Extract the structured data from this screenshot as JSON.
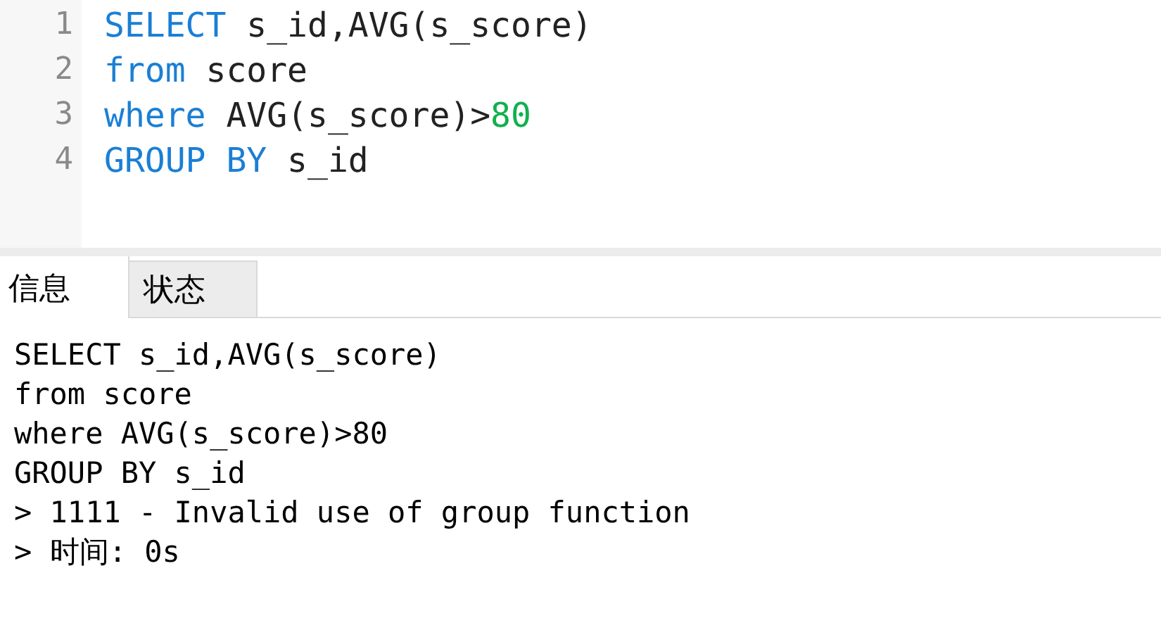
{
  "editor": {
    "lines": [
      {
        "number": "1",
        "tokens": [
          {
            "kind": "keyword",
            "text": "SELECT"
          },
          {
            "kind": "plain",
            "text": " s_id,AVG(s_score)"
          }
        ]
      },
      {
        "number": "2",
        "tokens": [
          {
            "kind": "keyword",
            "text": "from"
          },
          {
            "kind": "plain",
            "text": " score"
          }
        ]
      },
      {
        "number": "3",
        "tokens": [
          {
            "kind": "keyword",
            "text": "where"
          },
          {
            "kind": "plain",
            "text": " AVG(s_score)>"
          },
          {
            "kind": "number",
            "text": "80"
          }
        ]
      },
      {
        "number": "4",
        "tokens": [
          {
            "kind": "keyword",
            "text": "GROUP BY"
          },
          {
            "kind": "plain",
            "text": " s_id"
          }
        ]
      }
    ]
  },
  "tabs": [
    {
      "label": "信息",
      "selected": true
    },
    {
      "label": "状态",
      "selected": false
    }
  ],
  "output": {
    "lines": [
      "SELECT s_id,AVG(s_score)",
      "from score",
      "where AVG(s_score)>80",
      "GROUP BY s_id",
      "> 1111 - Invalid use of group function",
      "> 时间: 0s"
    ]
  }
}
